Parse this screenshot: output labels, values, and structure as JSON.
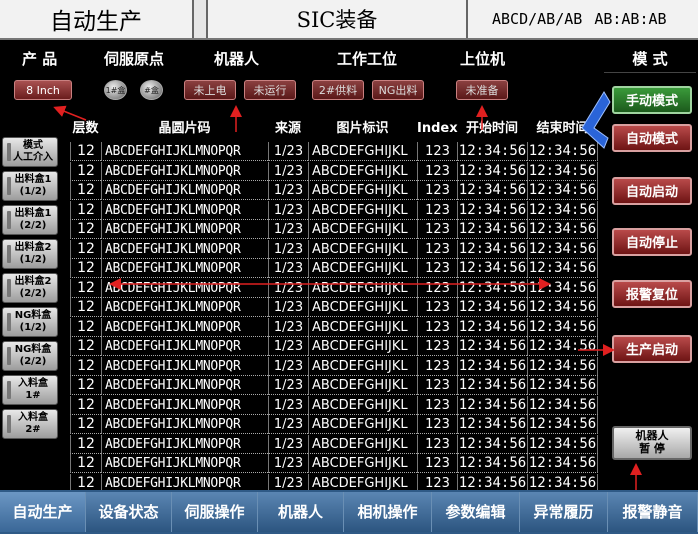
{
  "title": {
    "app": "自动生产",
    "device": "SIC装备",
    "code": "ABCD/AB/AB",
    "time": "AB:AB:AB"
  },
  "header": {
    "product": "产 品",
    "servo_origin": "伺服原点",
    "robot": "机器人",
    "station": "工作工位",
    "host": "上位机",
    "mode": "模 式"
  },
  "status": {
    "size": "8 Inch",
    "circle1": "1#盒",
    "circle2": "#盒",
    "robot_power": "未上电",
    "robot_run": "未运行",
    "station_feed": "2#供料",
    "station_ng": "NG出料",
    "host_ready": "未准备"
  },
  "left_buttons": [
    {
      "l1": "模式",
      "l2": "人工介入"
    },
    {
      "l1": "出料盒1",
      "l2": "(1/2)"
    },
    {
      "l1": "出料盒1",
      "l2": "(2/2)"
    },
    {
      "l1": "出料盒2",
      "l2": "(1/2)"
    },
    {
      "l1": "出料盒2",
      "l2": "(2/2)"
    },
    {
      "l1": "NG料盒",
      "l2": "(1/2)"
    },
    {
      "l1": "NG料盒",
      "l2": "(2/2)"
    },
    {
      "l1": "入料盒",
      "l2": "1#"
    },
    {
      "l1": "入料盒",
      "l2": "2#"
    }
  ],
  "table": {
    "columns": [
      "层数",
      "晶圆片码",
      "来源",
      "图片标识",
      "Index",
      "开始时间",
      "结束时间"
    ],
    "rows": [
      [
        "12",
        "ABCDEFGHIJKLMNOPQR",
        "1/23",
        "ABCDEFGHIJKL",
        "123",
        "12:34:56",
        "12:34:56"
      ],
      [
        "12",
        "ABCDEFGHIJKLMNOPQR",
        "1/23",
        "ABCDEFGHIJKL",
        "123",
        "12:34:56",
        "12:34:56"
      ],
      [
        "12",
        "ABCDEFGHIJKLMNOPQR",
        "1/23",
        "ABCDEFGHIJKL",
        "123",
        "12:34:56",
        "12:34:56"
      ],
      [
        "12",
        "ABCDEFGHIJKLMNOPQR",
        "1/23",
        "ABCDEFGHIJKL",
        "123",
        "12:34:56",
        "12:34:56"
      ],
      [
        "12",
        "ABCDEFGHIJKLMNOPQR",
        "1/23",
        "ABCDEFGHIJKL",
        "123",
        "12:34:56",
        "12:34:56"
      ],
      [
        "12",
        "ABCDEFGHIJKLMNOPQR",
        "1/23",
        "ABCDEFGHIJKL",
        "123",
        "12:34:56",
        "12:34:56"
      ],
      [
        "12",
        "ABCDEFGHIJKLMNOPQR",
        "1/23",
        "ABCDEFGHIJKL",
        "123",
        "12:34:56",
        "12:34:56"
      ],
      [
        "12",
        "ABCDEFGHIJKLMNOPQR",
        "1/23",
        "ABCDEFGHIJKL",
        "123",
        "12:34:56",
        "12:34:56"
      ],
      [
        "12",
        "ABCDEFGHIJKLMNOPQR",
        "1/23",
        "ABCDEFGHIJKL",
        "123",
        "12:34:56",
        "12:34:56"
      ],
      [
        "12",
        "ABCDEFGHIJKLMNOPQR",
        "1/23",
        "ABCDEFGHIJKL",
        "123",
        "12:34:56",
        "12:34:56"
      ],
      [
        "12",
        "ABCDEFGHIJKLMNOPQR",
        "1/23",
        "ABCDEFGHIJKL",
        "123",
        "12:34:56",
        "12:34:56"
      ],
      [
        "12",
        "ABCDEFGHIJKLMNOPQR",
        "1/23",
        "ABCDEFGHIJKL",
        "123",
        "12:34:56",
        "12:34:56"
      ],
      [
        "12",
        "ABCDEFGHIJKLMNOPQR",
        "1/23",
        "ABCDEFGHIJKL",
        "123",
        "12:34:56",
        "12:34:56"
      ],
      [
        "12",
        "ABCDEFGHIJKLMNOPQR",
        "1/23",
        "ABCDEFGHIJKL",
        "123",
        "12:34:56",
        "12:34:56"
      ],
      [
        "12",
        "ABCDEFGHIJKLMNOPQR",
        "1/23",
        "ABCDEFGHIJKL",
        "123",
        "12:34:56",
        "12:34:56"
      ],
      [
        "12",
        "ABCDEFGHIJKLMNOPQR",
        "1/23",
        "ABCDEFGHIJKL",
        "123",
        "12:34:56",
        "12:34:56"
      ],
      [
        "12",
        "ABCDEFGHIJKLMNOPQR",
        "1/23",
        "ABCDEFGHIJKL",
        "123",
        "12:34:56",
        "12:34:56"
      ],
      [
        "12",
        "ABCDEFGHIJKLMNOPQR",
        "1/23",
        "ABCDEFGHIJKL",
        "123",
        "12:34:56",
        "12:34:56"
      ]
    ]
  },
  "right_buttons": {
    "manual": "手动模式",
    "auto": "自动模式",
    "auto_start": "自动启动",
    "auto_stop": "自动停止",
    "alarm_reset": "报警复位",
    "prod_start": "生产启动",
    "robot_pause_1": "机器人",
    "robot_pause_2": "暂 停"
  },
  "tabs": [
    "自动生产",
    "设备状态",
    "伺服操作",
    "机器人",
    "相机操作",
    "参数编辑",
    "异常履历",
    "报警静音"
  ],
  "colors": {
    "background": "#000000",
    "tab_bar": "#2f5a86",
    "button_red": "#8b2a2a",
    "button_green": "#2a7a2a",
    "annotation_red": "#e02020",
    "annotation_blue": "#2a64d8"
  }
}
